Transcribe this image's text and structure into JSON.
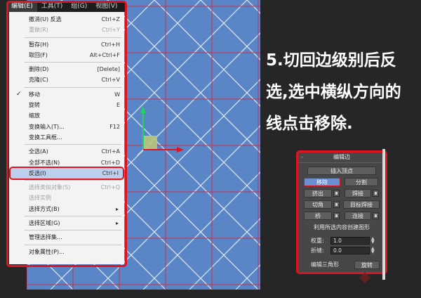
{
  "menubar": {
    "items": [
      {
        "label": "编辑(E)",
        "active": true
      },
      {
        "label": "工具(T)",
        "active": false
      },
      {
        "label": "组(G)",
        "active": false
      },
      {
        "label": "视图(V)",
        "active": false
      }
    ]
  },
  "edit_menu": {
    "rows": [
      {
        "label": "撤消(U) 反选",
        "shortcut": "Ctrl+Z",
        "state": "normal"
      },
      {
        "label": "重做(R)",
        "shortcut": "Ctrl+Y",
        "state": "disabled"
      },
      {
        "sep": true
      },
      {
        "label": "暂存(H)",
        "shortcut": "Ctrl+H",
        "state": "normal"
      },
      {
        "label": "取回(F)",
        "shortcut": "Alt+Ctrl+F",
        "state": "normal"
      },
      {
        "sep": true
      },
      {
        "label": "删除(D)",
        "shortcut": "[Delete]",
        "state": "normal"
      },
      {
        "label": "克隆(C)",
        "shortcut": "Ctrl+V",
        "state": "normal"
      },
      {
        "sep": true
      },
      {
        "label": "移动",
        "shortcut": "W",
        "state": "checked"
      },
      {
        "label": "旋转",
        "shortcut": "E",
        "state": "normal"
      },
      {
        "label": "缩放",
        "shortcut": "",
        "state": "normal"
      },
      {
        "label": "变换输入(T)...",
        "shortcut": "F12",
        "state": "normal"
      },
      {
        "label": "变换工具框...",
        "shortcut": "",
        "state": "normal"
      },
      {
        "sep": true
      },
      {
        "label": "全选(A)",
        "shortcut": "Ctrl+A",
        "state": "normal"
      },
      {
        "label": "全部不选(N)",
        "shortcut": "Ctrl+D",
        "state": "normal"
      },
      {
        "label": "反选(I)",
        "shortcut": "Ctrl+I",
        "state": "selected"
      },
      {
        "sep": true
      },
      {
        "label": "选择类似对象(S)",
        "shortcut": "Ctrl+Q",
        "state": "disabled"
      },
      {
        "label": "选择实例",
        "shortcut": "",
        "state": "disabled"
      },
      {
        "label": "选择方式(B)",
        "shortcut": "",
        "state": "submenu"
      },
      {
        "sep": true
      },
      {
        "label": "选择区域(G)",
        "shortcut": "",
        "state": "submenu"
      },
      {
        "sep": true
      },
      {
        "label": "管理选择集...",
        "shortcut": "",
        "state": "normal"
      },
      {
        "sep": true
      },
      {
        "label": "对象属性(P)...",
        "shortcut": "",
        "state": "normal"
      }
    ]
  },
  "caption": {
    "lines": [
      "5.切回边级别后反",
      "选,选中横纵方向的",
      "线点击移除."
    ]
  },
  "panel": {
    "title": "编辑边",
    "collapse": "-",
    "insert_vertex": "插入顶点",
    "remove": "移除",
    "split": "分割",
    "extrude": "挤出",
    "weld": "焊接",
    "chamfer": "切角",
    "target_weld": "目标焊接",
    "bridge": "桥",
    "connect": "连接",
    "create_shape": "利用所选内容创建图形",
    "weight_label": "权重:",
    "weight_value": "1.0",
    "crease_label": "折缝:",
    "crease_value": "0.0",
    "edit_tri": "编辑三角形",
    "turn": "旋转"
  },
  "colors": {
    "viewport": "#5a86c8",
    "grid_red": "#c8324a",
    "gizmo_y": "#1fd35b",
    "gizmo_x": "#e0141e",
    "highlight": "#e0141e"
  }
}
